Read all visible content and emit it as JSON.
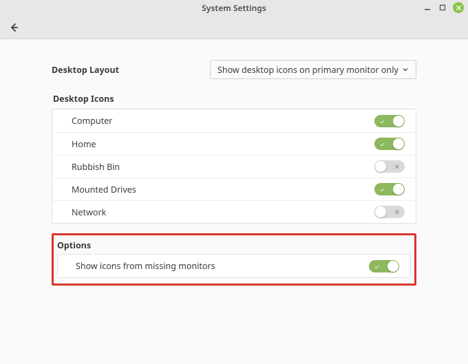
{
  "window": {
    "title": "System Settings"
  },
  "layout": {
    "label": "Desktop Layout",
    "dropdown_value": "Show desktop icons on primary monitor only"
  },
  "icons": {
    "title": "Desktop Icons",
    "items": [
      {
        "label": "Computer",
        "on": true
      },
      {
        "label": "Home",
        "on": true
      },
      {
        "label": "Rubbish Bin",
        "on": false
      },
      {
        "label": "Mounted Drives",
        "on": true
      },
      {
        "label": "Network",
        "on": false
      }
    ]
  },
  "options": {
    "title": "Options",
    "items": [
      {
        "label": "Show icons from missing monitors",
        "on": true
      }
    ]
  }
}
